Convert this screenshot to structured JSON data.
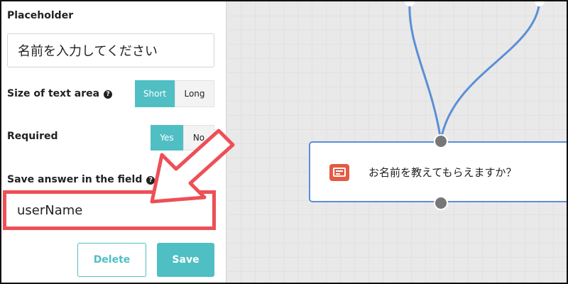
{
  "panel": {
    "placeholder_label": "Placeholder",
    "placeholder_value": "名前を入力してください",
    "size_label": "Size of text area",
    "size_options": [
      "Short",
      "Long"
    ],
    "size_selected": "Short",
    "required_label": "Required",
    "required_options": [
      "Yes",
      "No"
    ],
    "required_selected": "Yes",
    "save_field_label": "Save answer in the field",
    "save_field_value": "userName",
    "delete_label": "Delete",
    "save_label": "Save"
  },
  "canvas": {
    "node_text": "お名前を教えてもらえますか？",
    "node_icon": "chat-message-icon"
  },
  "annotation": {
    "color": "#ee4f57"
  },
  "colors": {
    "accent": "#4fbfc4",
    "connector": "#5b8fd6"
  }
}
